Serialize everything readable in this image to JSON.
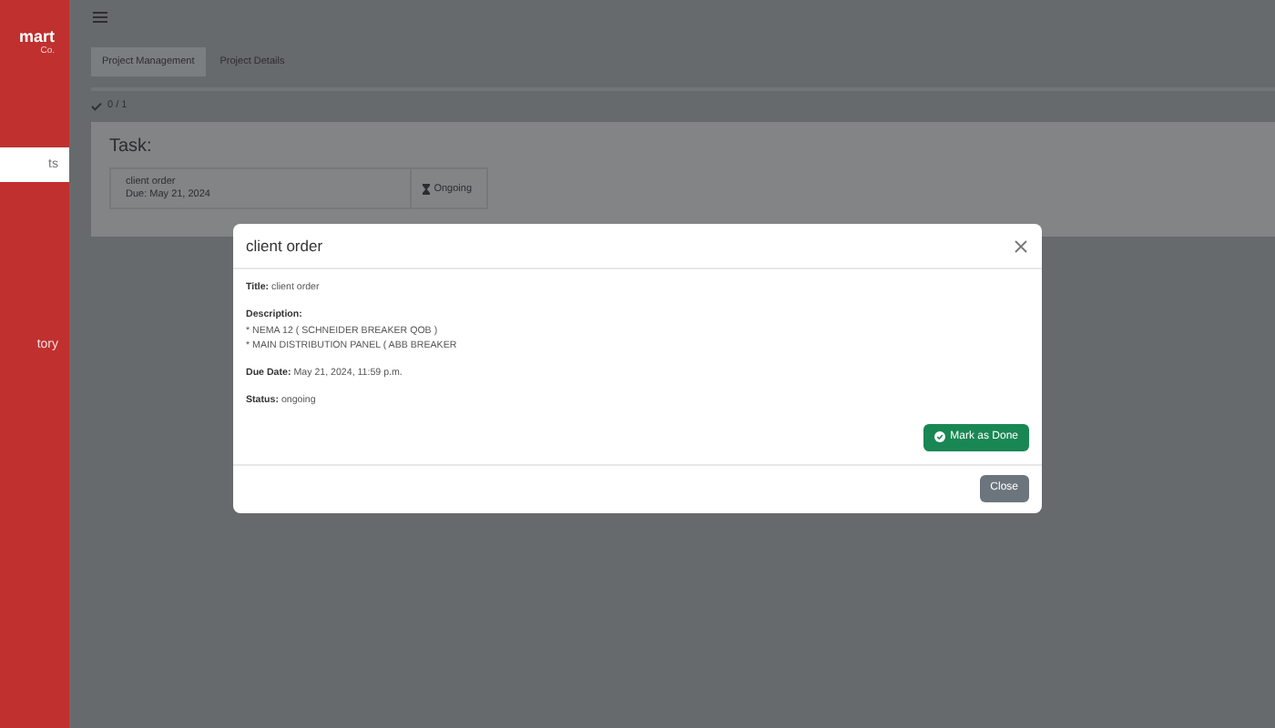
{
  "sidebar": {
    "brand": "mart",
    "brand_sub": "Co.",
    "items": [
      {
        "label": "ts",
        "selected": true
      },
      {
        "label": "tory",
        "selected": false
      }
    ]
  },
  "tabs": [
    {
      "label": "Project Management",
      "selected": true
    },
    {
      "label": "Project Details",
      "selected": false
    }
  ],
  "progress": "0 / 1",
  "task_card": {
    "heading": "Task:",
    "task": {
      "title": "client order",
      "due": "Due: May 21, 2024",
      "status": "Ongoing"
    }
  },
  "modal": {
    "title": "client order",
    "fields": [
      {
        "label": "Title:",
        "lines": [
          "client order"
        ]
      },
      {
        "label": "Description:",
        "lines": [
          "* NEMA 12 ( SCHNEIDER BREAKER QOB )",
          "* MAIN DISTRIBUTION PANEL ( ABB BREAKER"
        ]
      },
      {
        "label": "Due Date:",
        "lines": [
          "May 21, 2024, 11:59 p.m."
        ]
      },
      {
        "label": "Status:",
        "lines": [
          "ongoing"
        ]
      }
    ],
    "primary_button": "Mark as Done",
    "close_button": "Close"
  }
}
